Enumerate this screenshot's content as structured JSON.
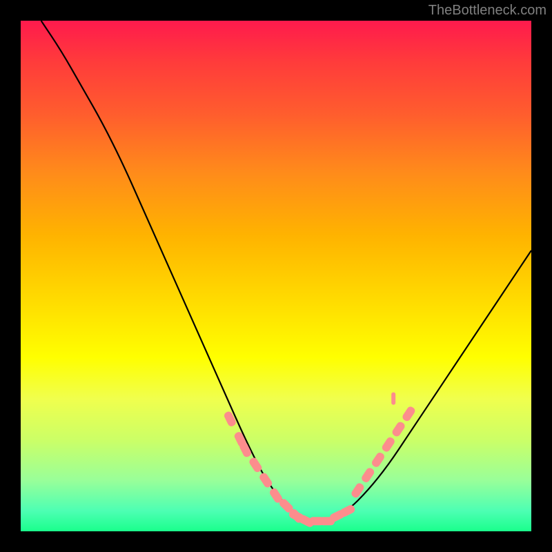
{
  "watermark": "TheBottleneck.com",
  "chart_data": {
    "type": "line",
    "title": "",
    "xlabel": "",
    "ylabel": "",
    "xlim": [
      0,
      100
    ],
    "ylim": [
      0,
      100
    ],
    "background_gradient_colors": [
      "#ff1a4d",
      "#ff3b3b",
      "#ff5c2e",
      "#ff8c1a",
      "#ffb300",
      "#ffd900",
      "#ffff00",
      "#f0ff4d",
      "#ccff66",
      "#99ff99",
      "#4dffb3",
      "#1aff8c"
    ],
    "series": [
      {
        "name": "bottleneck-curve",
        "color": "#000000",
        "x": [
          4,
          8,
          12,
          16,
          20,
          24,
          28,
          32,
          36,
          40,
          44,
          48,
          52,
          56,
          60,
          64,
          68,
          72,
          76,
          80,
          84,
          88,
          92,
          96,
          100
        ],
        "y": [
          100,
          94,
          87,
          80,
          72,
          63,
          54,
          45,
          36,
          27,
          18,
          10,
          5,
          2,
          2,
          4,
          8,
          13,
          19,
          25,
          31,
          37,
          43,
          49,
          55
        ]
      }
    ],
    "markers": [
      {
        "name": "highlight-cluster-left",
        "color": "#fc8d8d",
        "shape": "rounded-rect",
        "x": [
          41,
          43,
          44,
          46,
          48,
          50,
          52,
          54,
          56
        ],
        "y": [
          22,
          18,
          16,
          13,
          10,
          7,
          5,
          3,
          2
        ]
      },
      {
        "name": "highlight-cluster-right",
        "color": "#fc8d8d",
        "shape": "rounded-rect",
        "x": [
          66,
          68,
          70,
          72,
          74,
          76
        ],
        "y": [
          8,
          11,
          14,
          17,
          20,
          23
        ]
      },
      {
        "name": "highlight-cluster-bottom",
        "color": "#fc8d8d",
        "shape": "rounded-rect",
        "x": [
          54,
          56,
          58,
          60,
          62,
          64
        ],
        "y": [
          3,
          2,
          2,
          2,
          3,
          4
        ]
      }
    ],
    "single_markers": [
      {
        "name": "tick-upper-right",
        "color": "#fc8d8d",
        "x": 73,
        "y": 26
      }
    ]
  }
}
